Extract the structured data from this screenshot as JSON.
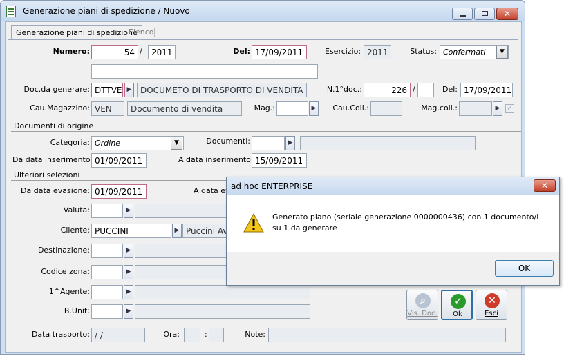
{
  "window": {
    "title": "Generazione piani di spedizione / Nuovo"
  },
  "tabs": [
    {
      "label": "Generazione piani di spedizione"
    },
    {
      "label": "Elenco"
    }
  ],
  "header": {
    "numero_label": "Numero:",
    "numero": "54",
    "slash": "/",
    "anno": "2011",
    "del_label": "Del:",
    "del": "17/09/2011",
    "esercizio_label": "Esercizio:",
    "esercizio": "2011",
    "status_label": "Status:",
    "status": "Confermati"
  },
  "doc": {
    "label": "Doc.da generare:",
    "code": "DTTVE",
    "desc": "DOCUMETO DI TRASPORTO DI VENDITA",
    "n1doc_label": "N.1°doc.:",
    "n1doc": "226",
    "slash": "/",
    "del_label": "Del:",
    "del": "17/09/2011",
    "caumag_label": "Cau.Magazzino:",
    "caumag": "VEN",
    "caumag_desc": "Documento di vendita",
    "mag_label": "Mag.:",
    "caucoll_label": "Cau.Coll.:",
    "magcoll_label": "Mag.coll.:"
  },
  "origine": {
    "section": "Documenti di origine",
    "categoria_label": "Categoria:",
    "categoria": "Ordine",
    "documenti_label": "Documenti:",
    "da_data_ins_label": "Da data inserimento:",
    "da_data_ins": "01/09/2011",
    "a_data_ins_label": "A data inserimento:",
    "a_data_ins": "15/09/2011"
  },
  "ulteriori": {
    "section": "Ulteriori selezioni",
    "da_data_eva_label": "Da data evasione:",
    "da_data_eva": "01/09/2011",
    "a_data_eva_label": "A data ev",
    "valuta_label": "Valuta:",
    "cliente_label": "Cliente:",
    "cliente": "PUCCINI",
    "cliente_desc": "Puccini Avv",
    "destinazione_label": "Destinazione:",
    "codice_zona_label": "Codice zona:",
    "agente_label": "1^Agente:",
    "bunit_label": "B.Unit:",
    "data_trasporto_label": "Data trasporto:",
    "data_trasporto": " /  /",
    "ora_label": "Ora:",
    "ora_sep": ":",
    "note_label": "Note:"
  },
  "buttons": {
    "visdoc": "Vis. Doc.",
    "ok": "Ok",
    "esci": "Esci"
  },
  "dialog": {
    "title": "ad hoc ENTERPRISE",
    "message": "Generato piano (seriale generazione 0000000436) con 1 documento/i su 1 da generare",
    "ok": "OK"
  },
  "colors": {
    "required_border": "#c06a8a",
    "ok_green": "#2a9a2a",
    "esci_red": "#d03a2a"
  }
}
